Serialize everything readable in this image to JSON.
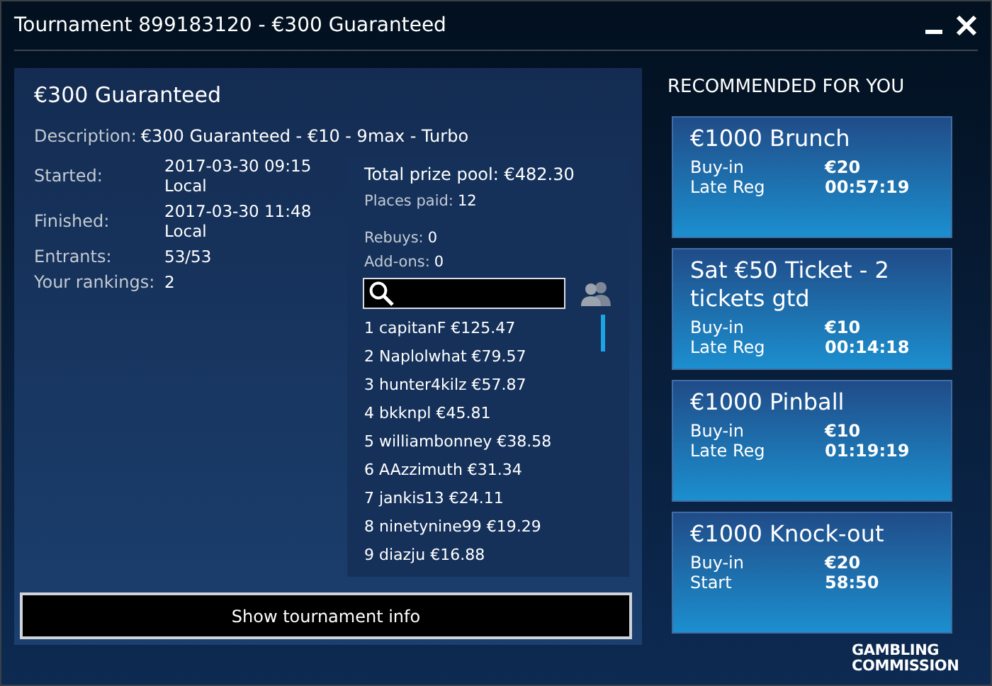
{
  "window": {
    "title": "Tournament 899183120 - €300 Guaranteed"
  },
  "details": {
    "heading": "€300 Guaranteed",
    "description_label": "Description:",
    "description": "€300 Guaranteed - €10 - 9max - Turbo",
    "fields": [
      {
        "label": "Started:",
        "value": "2017-03-30 09:15 Local"
      },
      {
        "label": "Finished:",
        "value": "2017-03-30 11:48 Local"
      },
      {
        "label": "Entrants:",
        "value": "53/53"
      },
      {
        "label": "Your rankings:",
        "value": "2"
      }
    ]
  },
  "prizes": {
    "total": "Total prize pool: €482.30",
    "places_label": "Places paid:",
    "places": "12",
    "rebuys_label": "Rebuys:",
    "rebuys": "0",
    "addons_label": "Add-ons:",
    "addons": "0",
    "rankings": [
      "1 capitanF €125.47",
      "2 Naplolwhat €79.57",
      "3 hunter4kilz €57.87",
      "4 bkknpl €45.81",
      "5 williambonney €38.58",
      "6 AAzzimuth €31.34",
      "7 jankis13 €24.11",
      "8 ninetynine99 €19.29",
      "9 diazju €16.88"
    ]
  },
  "show_info_button": "Show tournament info",
  "recommended": {
    "heading": "RECOMMENDED FOR YOU",
    "cards": [
      {
        "title": "€1000 Brunch",
        "rows": [
          {
            "label": "Buy-in",
            "value": "€20"
          },
          {
            "label": "Late Reg",
            "value": "00:57:19"
          }
        ]
      },
      {
        "title": "Sat €50 Ticket - 2 tickets gtd",
        "rows": [
          {
            "label": "Buy-in",
            "value": "€10"
          },
          {
            "label": "Late Reg",
            "value": "00:14:18"
          }
        ]
      },
      {
        "title": "€1000 Pinball",
        "rows": [
          {
            "label": "Buy-in",
            "value": "€10"
          },
          {
            "label": "Late Reg",
            "value": "01:19:19"
          }
        ]
      },
      {
        "title": "€1000 Knock-out",
        "rows": [
          {
            "label": "Buy-in",
            "value": "€20"
          },
          {
            "label": "Start",
            "value": "58:50"
          }
        ]
      }
    ]
  },
  "logo": "GAMBLING COMMISSION"
}
